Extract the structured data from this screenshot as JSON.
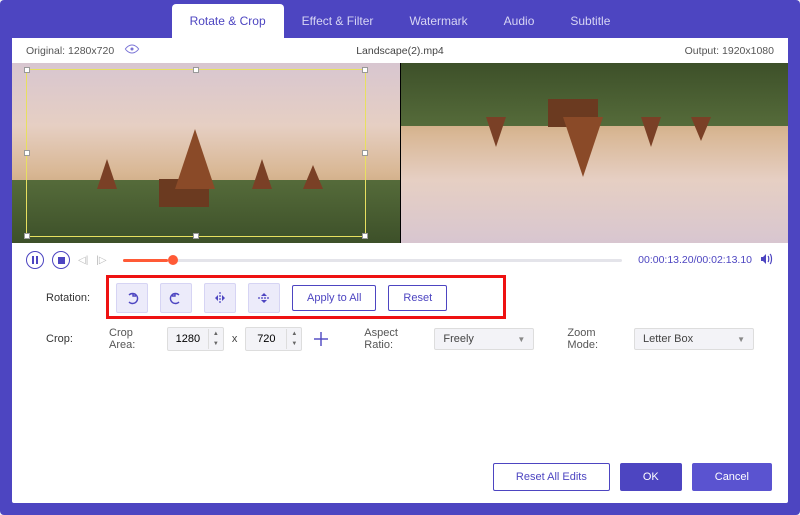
{
  "window": {
    "minimize": "—",
    "maximize": "▢",
    "close": "✕"
  },
  "tabs": {
    "rotate_crop": "Rotate & Crop",
    "effect_filter": "Effect & Filter",
    "watermark": "Watermark",
    "audio": "Audio",
    "subtitle": "Subtitle"
  },
  "info": {
    "original_label": "Original:",
    "original_res": "1280x720",
    "filename": "Landscape(2).mp4",
    "output_label": "Output:",
    "output_res": "1920x1080"
  },
  "playback": {
    "current": "00:00:13.20",
    "sep": "/",
    "duration": "00:02:13.10"
  },
  "rotation": {
    "label": "Rotation:",
    "apply_all": "Apply to All",
    "reset": "Reset"
  },
  "crop": {
    "label": "Crop:",
    "crop_area": "Crop Area:",
    "width": "1280",
    "height": "720",
    "x": "x",
    "aspect_label": "Aspect Ratio:",
    "aspect_value": "Freely",
    "zoom_label": "Zoom Mode:",
    "zoom_value": "Letter Box"
  },
  "footer": {
    "reset_all": "Reset All Edits",
    "ok": "OK",
    "cancel": "Cancel"
  },
  "icons": {
    "rotate_left": "rotate-left-icon",
    "rotate_right": "rotate-right-icon",
    "flip_h": "flip-horizontal-icon",
    "flip_v": "flip-vertical-icon"
  }
}
